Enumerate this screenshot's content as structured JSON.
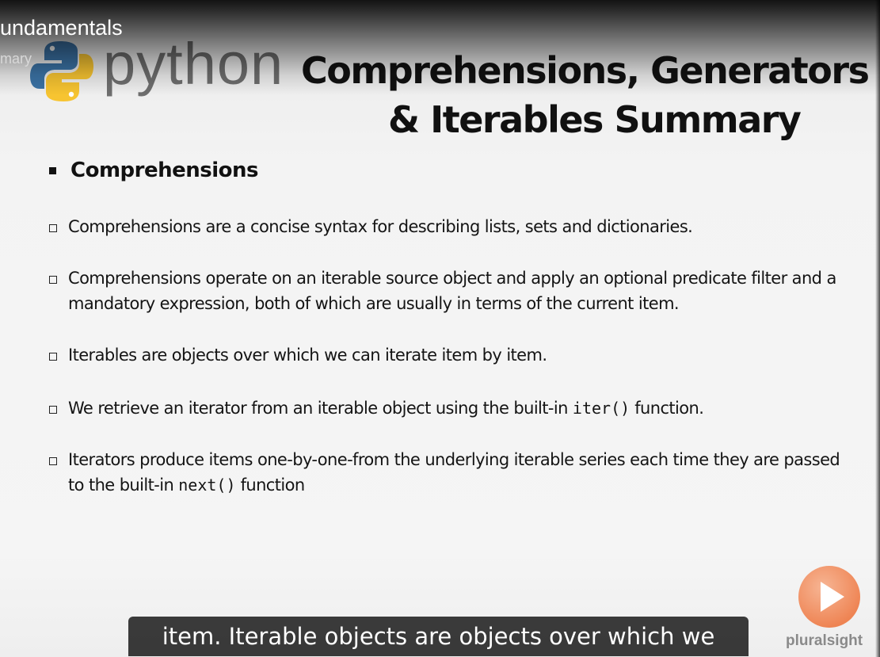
{
  "player": {
    "course_title": "undamentals",
    "module_title": "mary"
  },
  "slide": {
    "logo_text": "python",
    "title_line1": "Comprehensions, Generators",
    "title_line2": "& Iterables Summary",
    "section_heading": "Comprehensions",
    "bullets": [
      {
        "text": "Comprehensions are a concise syntax for describing lists, sets and dictionaries."
      },
      {
        "text": "Comprehensions operate on an iterable source object and apply an optional predicate filter and a mandatory expression, both of which are usually in terms of the current item."
      },
      {
        "text": "Iterables are objects over which we can iterate item by item."
      },
      {
        "before": "We retrieve an iterator from an iterable object using the built-in ",
        "code": "iter()",
        "after": " function."
      },
      {
        "before": "Iterators produce items one-by-one-from the underlying iterable series each time they are passed to the built-in ",
        "code": "next()",
        "after": " function"
      }
    ]
  },
  "caption": {
    "text": "item. Iterable objects are objects over which we"
  },
  "branding": {
    "name": "pluralsight",
    "play_icon": "play-icon",
    "logo_icon": "python-logo-icon"
  },
  "colors": {
    "python_blue": "#3b73a6",
    "python_yellow": "#f7c431",
    "play_orange": "#f08a5a"
  }
}
